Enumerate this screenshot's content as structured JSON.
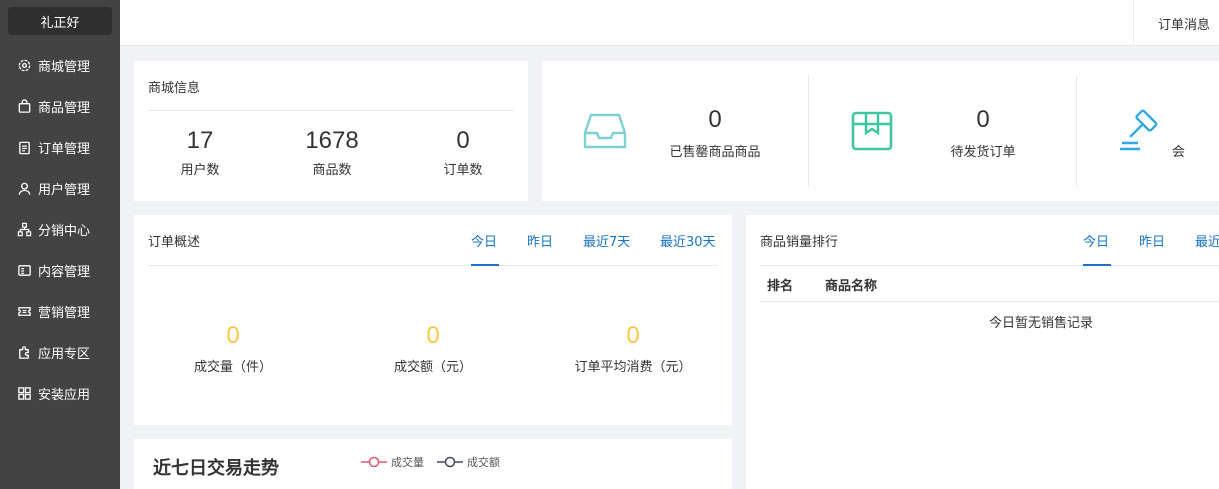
{
  "brand": "礼正好",
  "sidebar": {
    "items": [
      {
        "label": "商城管理",
        "icon": "gear-icon"
      },
      {
        "label": "商品管理",
        "icon": "shopping-bag-icon"
      },
      {
        "label": "订单管理",
        "icon": "clipboard-icon"
      },
      {
        "label": "用户管理",
        "icon": "user-icon"
      },
      {
        "label": "分销中心",
        "icon": "org-chart-icon"
      },
      {
        "label": "内容管理",
        "icon": "document-icon"
      },
      {
        "label": "营销管理",
        "icon": "ticket-icon"
      },
      {
        "label": "应用专区",
        "icon": "puzzle-icon"
      },
      {
        "label": "安装应用",
        "icon": "grid-icon"
      }
    ]
  },
  "topbar": {
    "message": "订单消息"
  },
  "shop_info": {
    "title": "商城信息",
    "stats": [
      {
        "value": "17",
        "label": "用户数"
      },
      {
        "value": "1678",
        "label": "商品数"
      },
      {
        "value": "0",
        "label": "订单数"
      }
    ]
  },
  "summary": {
    "items": [
      {
        "value": "0",
        "label": "已售罄商品商品",
        "icon": "inbox-icon",
        "color": "#7fd1d1"
      },
      {
        "value": "0",
        "label": "待发货订单",
        "icon": "package-icon",
        "color": "#3cc7a3"
      },
      {
        "value": "",
        "label": "会",
        "icon": "gavel-icon",
        "color": "#31a7e6"
      }
    ]
  },
  "order_overview": {
    "title": "订单概述",
    "tabs": [
      "今日",
      "昨日",
      "最近7天",
      "最近30天"
    ],
    "stats": [
      {
        "value": "0",
        "label": "成交量（件）"
      },
      {
        "value": "0",
        "label": "成交额（元）"
      },
      {
        "value": "0",
        "label": "订单平均消费（元）"
      }
    ]
  },
  "sales_rank": {
    "title": "商品销量排行",
    "tabs": [
      "今日",
      "昨日",
      "最近"
    ],
    "columns": [
      "排名",
      "商品名称"
    ],
    "empty_text": "今日暂无销售记录"
  },
  "trend": {
    "title": "近七日交易走势",
    "legend": [
      {
        "name": "成交量",
        "color": "#e05a6a"
      },
      {
        "name": "成交额",
        "color": "#3e4a5a"
      }
    ]
  },
  "colors": {
    "accent": "#1a73c6",
    "highlight": "#f7c948",
    "sidebar": "#434343"
  }
}
